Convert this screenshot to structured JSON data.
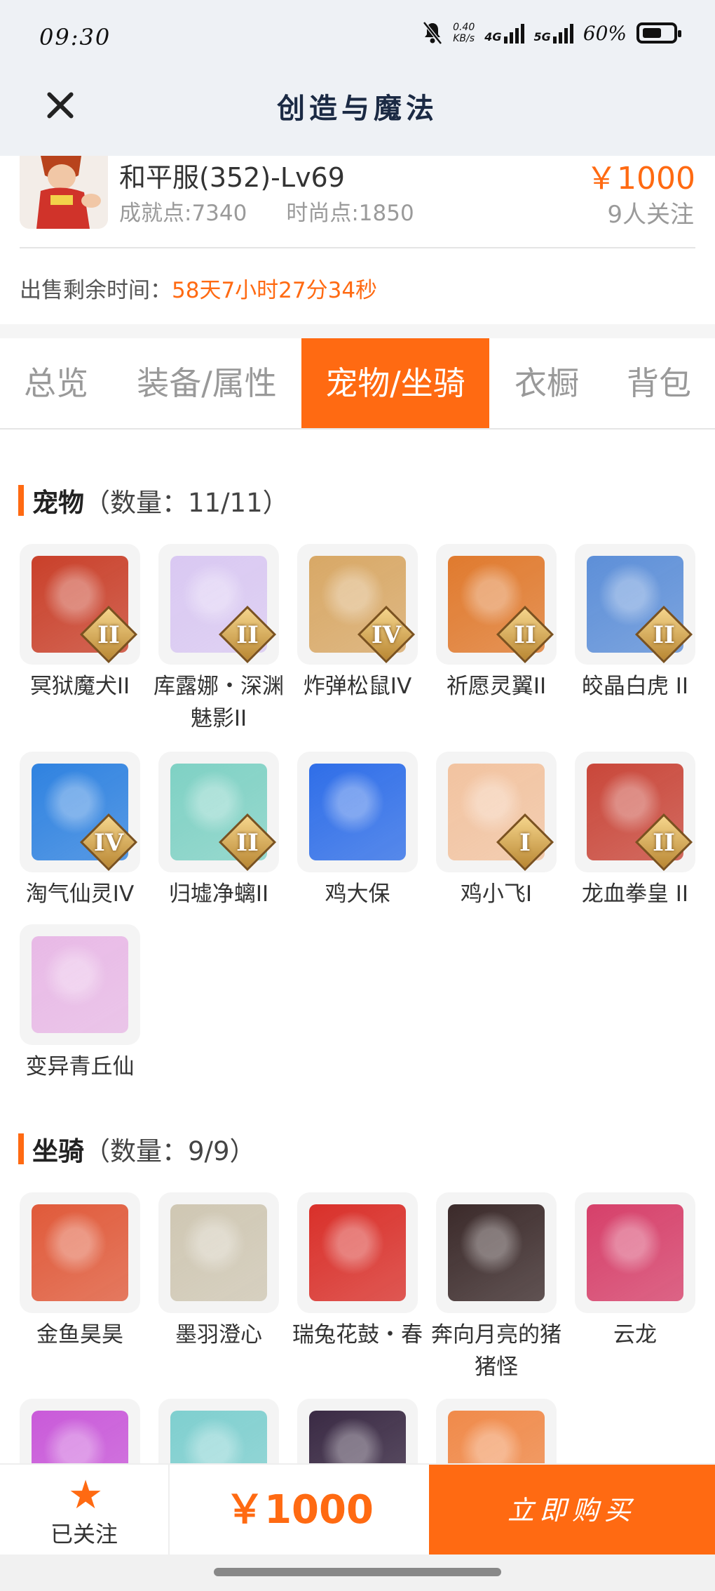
{
  "status": {
    "time": "09:30",
    "speed_value": "0.40",
    "speed_unit": "KB/s",
    "net1": "4G",
    "net2": "5G",
    "battery": "60%"
  },
  "nav": {
    "title": "创造与魔法"
  },
  "seller": {
    "server": "和平服(352)-Lv69",
    "achievement": "成就点:7340",
    "fashion": "时尚点:1850",
    "price": "￥1000",
    "followers": "9人关注",
    "remain_label": "出售剩余时间：",
    "remain_value": "58天7小时27分34秒"
  },
  "tabs": [
    "总览",
    "装备/属性",
    "宠物/坐骑",
    "衣橱",
    "背包"
  ],
  "active_tab": "宠物/坐骑",
  "pets": {
    "title": "宠物",
    "count": "（数量：11/11）",
    "items": [
      {
        "name": "冥狱魔犬II",
        "tier": "II",
        "color": "#c9402a"
      },
      {
        "name": "库露娜・深渊魅影II",
        "tier": "II",
        "color": "#d9c8f2"
      },
      {
        "name": "炸弹松鼠IV",
        "tier": "IV",
        "color": "#d8a866"
      },
      {
        "name": "祈愿灵翼II",
        "tier": "II",
        "color": "#e07a2e"
      },
      {
        "name": "皎晶白虎 II",
        "tier": "II",
        "color": "#5d8fd8"
      },
      {
        "name": "淘气仙灵IV",
        "tier": "IV",
        "color": "#2f82e0"
      },
      {
        "name": "归墟净螭II",
        "tier": "II",
        "color": "#7fd1c4"
      },
      {
        "name": "鸡大保",
        "tier": "",
        "color": "#2f6ee8"
      },
      {
        "name": "鸡小飞I",
        "tier": "I",
        "color": "#f2c3a0"
      },
      {
        "name": "龙血拳皇 II",
        "tier": "II",
        "color": "#c9473a"
      },
      {
        "name": "变异青丘仙",
        "tier": "",
        "color": "#e8b9e6"
      }
    ]
  },
  "mounts": {
    "title": "坐骑",
    "count": "（数量：9/9）",
    "items": [
      {
        "name": "金鱼昊昊",
        "color": "#e05a3a"
      },
      {
        "name": "墨羽澄心",
        "color": "#cfc7b3"
      },
      {
        "name": "瑞兔花鼓・春",
        "color": "#d9302a"
      },
      {
        "name": "奔向月亮的猪猪怪",
        "color": "#3b2a2a"
      },
      {
        "name": "云龙",
        "color": "#d6406a"
      },
      {
        "name": "",
        "color": "#c95ad9"
      },
      {
        "name": "",
        "color": "#7fcfcf"
      },
      {
        "name": "",
        "color": "#3a2a44"
      },
      {
        "name": "",
        "color": "#f08a4a"
      }
    ]
  },
  "bottom": {
    "follow_label": "已关注",
    "price": "￥1000",
    "buy_label": "立即购买"
  }
}
